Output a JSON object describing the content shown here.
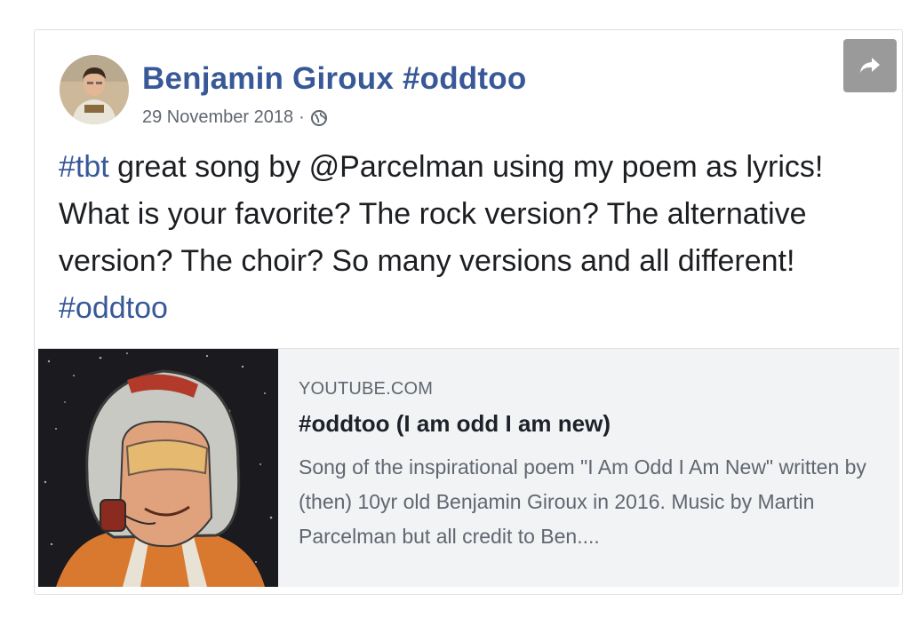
{
  "post": {
    "author": "Benjamin Giroux #oddtoo",
    "date": "29 November 2018",
    "separator": "·",
    "privacy_icon": "globe-icon",
    "share_icon": "share-arrow-icon",
    "text": {
      "tag1": "#tbt",
      "body": " great song by @Parcelman using my poem as lyrics! What is your favorite? The rock version? The alternative version? The choir? So many versions and all different! ",
      "tag2": "#oddtoo"
    }
  },
  "link_preview": {
    "domain": "YOUTUBE.COM",
    "title": "#oddtoo (I am odd I am new)",
    "description": "Song of the inspirational poem \"I Am Odd I Am New\" written by (then) 10yr old Benjamin Giroux in 2016. Music by Martin Parcelman but all credit to Ben...."
  },
  "colors": {
    "link": "#385898",
    "text": "#1c1e21",
    "muted": "#606770",
    "preview_bg": "#f2f3f5",
    "share_button": "#9a9a9a"
  }
}
